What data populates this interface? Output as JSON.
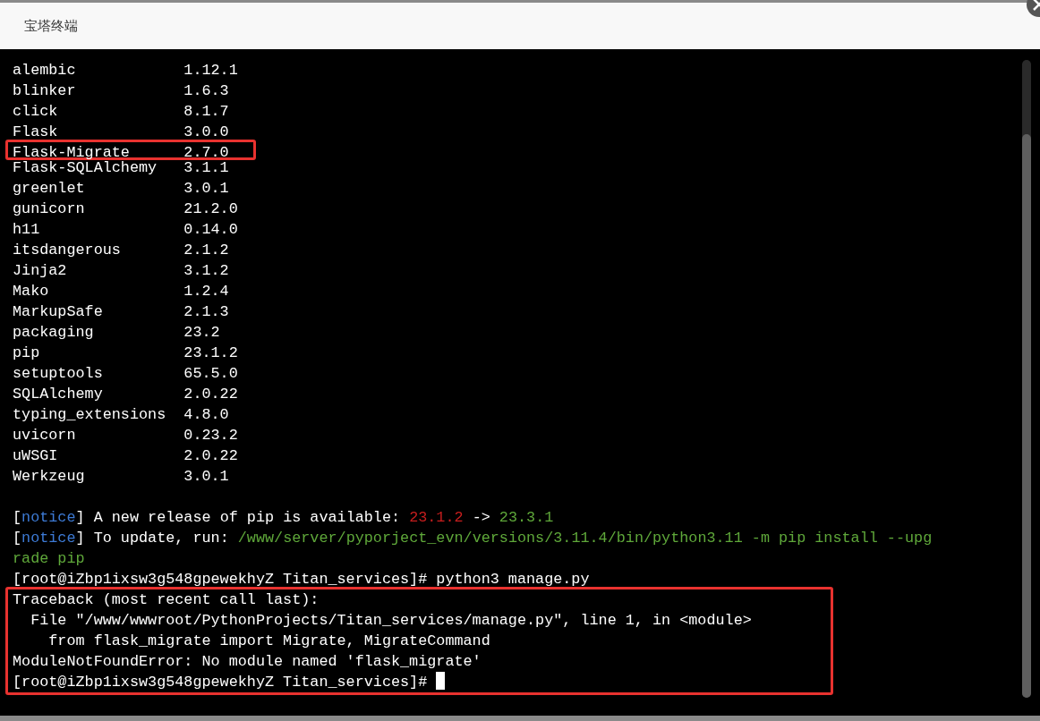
{
  "window": {
    "title": "宝塔终端"
  },
  "terminal": {
    "packages": [
      {
        "name": "alembic",
        "version": "1.12.1",
        "highlighted": false
      },
      {
        "name": "blinker",
        "version": "1.6.3",
        "highlighted": false
      },
      {
        "name": "click",
        "version": "8.1.7",
        "highlighted": false
      },
      {
        "name": "Flask",
        "version": "3.0.0",
        "highlighted": false
      },
      {
        "name": "Flask-Migrate",
        "version": "2.7.0",
        "highlighted": true
      },
      {
        "name": "Flask-SQLAlchemy",
        "version": "3.1.1",
        "highlighted": false
      },
      {
        "name": "greenlet",
        "version": "3.0.1",
        "highlighted": false
      },
      {
        "name": "gunicorn",
        "version": "21.2.0",
        "highlighted": false
      },
      {
        "name": "h11",
        "version": "0.14.0",
        "highlighted": false
      },
      {
        "name": "itsdangerous",
        "version": "2.1.2",
        "highlighted": false
      },
      {
        "name": "Jinja2",
        "version": "3.1.2",
        "highlighted": false
      },
      {
        "name": "Mako",
        "version": "1.2.4",
        "highlighted": false
      },
      {
        "name": "MarkupSafe",
        "version": "2.1.3",
        "highlighted": false
      },
      {
        "name": "packaging",
        "version": "23.2",
        "highlighted": false
      },
      {
        "name": "pip",
        "version": "23.1.2",
        "highlighted": false
      },
      {
        "name": "setuptools",
        "version": "65.5.0",
        "highlighted": false
      },
      {
        "name": "SQLAlchemy",
        "version": "2.0.22",
        "highlighted": false
      },
      {
        "name": "typing_extensions",
        "version": "4.8.0",
        "highlighted": false
      },
      {
        "name": "uvicorn",
        "version": "0.23.2",
        "highlighted": false
      },
      {
        "name": "uWSGI",
        "version": "2.0.22",
        "highlighted": false
      },
      {
        "name": "Werkzeug",
        "version": "3.0.1",
        "highlighted": false
      }
    ],
    "blocks": [
      {
        "highlighted": false,
        "lines": [
          {
            "segments": [
              {
                "text": "[",
                "kind": "plain"
              },
              {
                "text": "notice",
                "kind": "notice"
              },
              {
                "text": "] A new release of pip is available: ",
                "kind": "plain"
              },
              {
                "text": "23.1.2",
                "kind": "old"
              },
              {
                "text": " -> ",
                "kind": "plain"
              },
              {
                "text": "23.3.1",
                "kind": "new"
              }
            ]
          },
          {
            "segments": [
              {
                "text": "[",
                "kind": "plain"
              },
              {
                "text": "notice",
                "kind": "notice"
              },
              {
                "text": "] To update, run: ",
                "kind": "plain"
              },
              {
                "text": "/www/server/pyporject_evn/versions/3.11.4/bin/python3.11 -m pip install --upg",
                "kind": "new"
              }
            ]
          },
          {
            "segments": [
              {
                "text": "rade pip",
                "kind": "new"
              }
            ]
          },
          {
            "segments": [
              {
                "text": "[root@iZbp1ixsw3g548gpewekhyZ Titan_services]# python3 manage.py",
                "kind": "plain"
              }
            ]
          }
        ]
      },
      {
        "highlighted": true,
        "lines": [
          {
            "segments": [
              {
                "text": "Traceback (most recent call last):",
                "kind": "plain"
              }
            ]
          },
          {
            "segments": [
              {
                "text": "  File \"/www/wwwroot/PythonProjects/Titan_services/manage.py\", line 1, in <module>",
                "kind": "plain"
              }
            ]
          },
          {
            "segments": [
              {
                "text": "    from flask_migrate import Migrate, MigrateCommand",
                "kind": "plain"
              }
            ]
          },
          {
            "segments": [
              {
                "text": "ModuleNotFoundError: No module named 'flask_migrate'",
                "kind": "plain"
              }
            ]
          },
          {
            "segments": [
              {
                "text": "[root@iZbp1ixsw3g548gpewekhyZ Titan_services]# ",
                "kind": "plain"
              }
            ]
          }
        ]
      }
    ],
    "cursor": true
  }
}
